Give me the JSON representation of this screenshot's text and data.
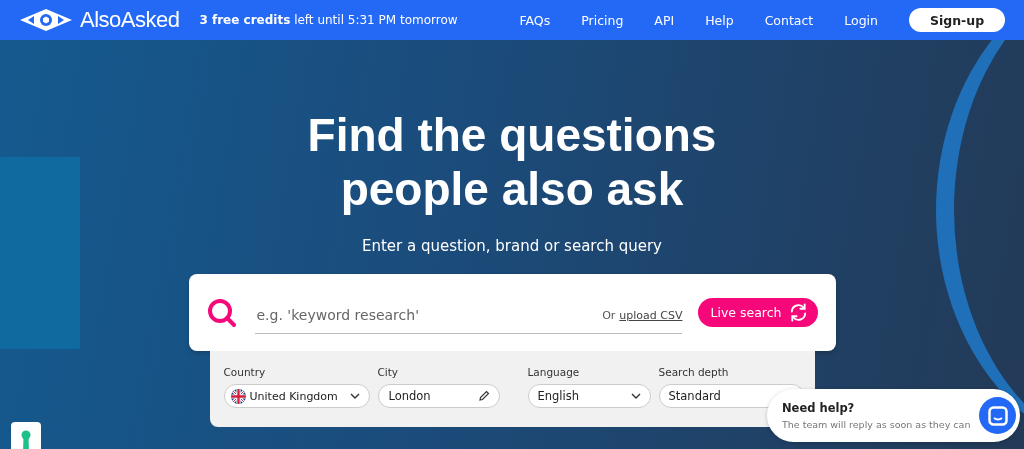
{
  "nav": {
    "logo": "AlsoAsked",
    "credits": "**3 free credits** left until 5:31 PM tomorrow",
    "links": [
      "FAQs",
      "Pricing",
      "API",
      "Help",
      "Contact",
      "Login"
    ],
    "signup": "Sign-up"
  },
  "hero": {
    "title": "Find the questions people also ask",
    "subtitle": "Enter a question, brand or search query"
  },
  "search": {
    "placeholder": "e.g. 'keyword research'",
    "upload_prefix": "Or",
    "upload_link": "upload CSV",
    "button": "Live search"
  },
  "filter_groups": [
    [
      {
        "kind": "country",
        "label": "Country",
        "value": "United Kingdom"
      },
      {
        "kind": "text",
        "label": "City",
        "value": "London"
      }
    ],
    [
      {
        "kind": "select",
        "label": "Language",
        "value": "English"
      },
      {
        "kind": "plain",
        "label": "Search depth",
        "value": "Standard"
      }
    ]
  ],
  "chat": {
    "title": "Need help?",
    "text": "The team will reply as soon as they can"
  }
}
